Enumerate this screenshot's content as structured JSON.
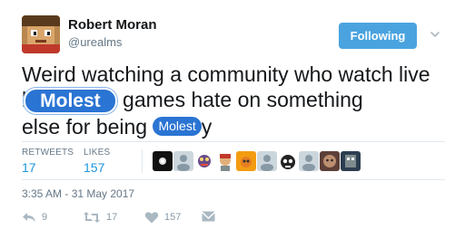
{
  "author": {
    "name": "Robert Moran",
    "handle": "@urealms"
  },
  "follow_button": {
    "label": "Following"
  },
  "tweet": {
    "line1": "Weird watching a community who watch live",
    "line2_prefix": "l",
    "censor_large": "Molest",
    "line2_rest": " games hate on something",
    "line3_prefix": "else for being ",
    "censor_small": "Molest",
    "line3_suffix": "y"
  },
  "stats": {
    "retweets_label": "RETWEETS",
    "retweets_value": "17",
    "likes_label": "LIKES",
    "likes_value": "157"
  },
  "likers": [
    {
      "icon": "liker-avatar-1"
    },
    {
      "icon": "liker-avatar-default"
    },
    {
      "icon": "liker-avatar-3"
    },
    {
      "icon": "liker-avatar-4"
    },
    {
      "icon": "liker-avatar-5"
    },
    {
      "icon": "liker-avatar-default"
    },
    {
      "icon": "liker-avatar-7"
    },
    {
      "icon": "liker-avatar-default"
    },
    {
      "icon": "liker-avatar-9"
    },
    {
      "icon": "liker-avatar-10"
    }
  ],
  "timestamp": "3:35 AM - 31 May 2017",
  "actions": {
    "reply_count": "9",
    "retweet_count": "17",
    "like_count": "157"
  },
  "colors": {
    "accent": "#1b95e0",
    "follow_bg": "#4aa3df",
    "censor_bg": "#2a74d3",
    "muted": "#657786"
  }
}
